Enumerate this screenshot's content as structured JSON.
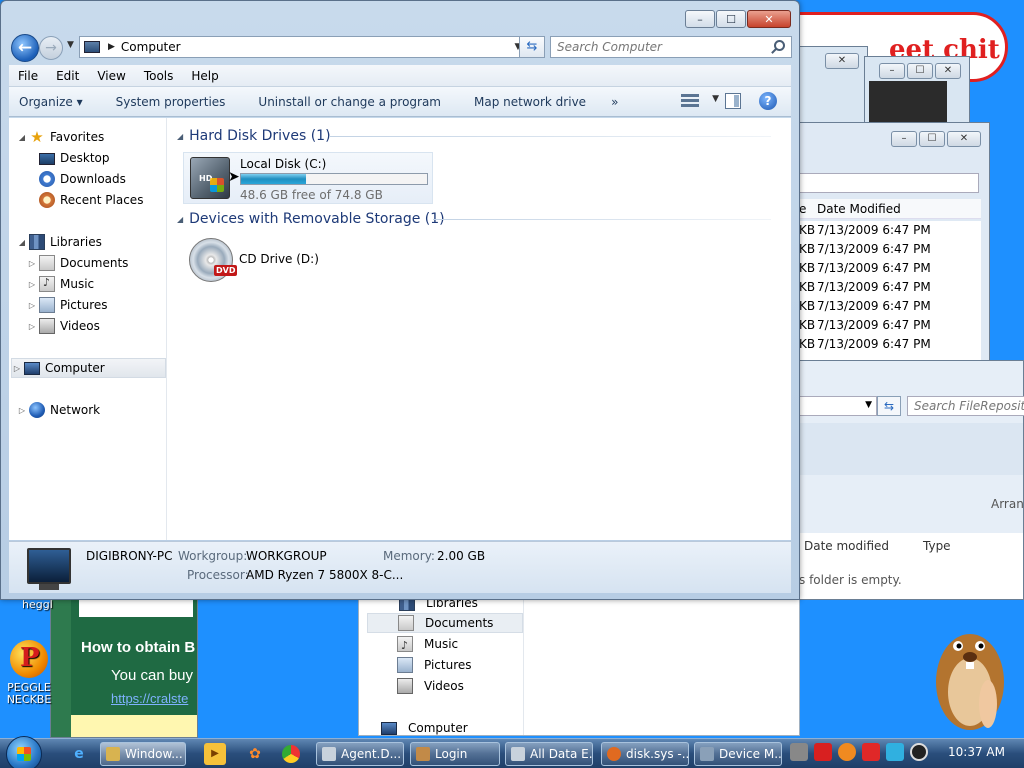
{
  "window": {
    "address": "Computer",
    "search_placeholder": "Search Computer",
    "controls": {
      "minimize": "–",
      "maximize": "☐",
      "close": "✕"
    }
  },
  "menu": [
    "File",
    "Edit",
    "View",
    "Tools",
    "Help"
  ],
  "command_bar": {
    "organize": "Organize ▾",
    "system_properties": "System properties",
    "uninstall": "Uninstall or change a program",
    "map_drive": "Map network drive",
    "more": "»"
  },
  "nav": {
    "favorites": "Favorites",
    "desktop": "Desktop",
    "downloads": "Downloads",
    "recent": "Recent Places",
    "libraries": "Libraries",
    "documents": "Documents",
    "music": "Music",
    "pictures": "Pictures",
    "videos": "Videos",
    "computer": "Computer",
    "network": "Network"
  },
  "groups": {
    "hdd": "Hard Disk Drives (1)",
    "removable": "Devices with Removable Storage (1)"
  },
  "drives": {
    "local": {
      "name": "Local Disk (C:)",
      "free": "48.6 GB free of 74.8 GB",
      "used_fraction": 0.35,
      "icon_text": "HD"
    },
    "cd": {
      "name": "CD Drive (D:)",
      "tag": "DVD"
    }
  },
  "details": {
    "pc_name": "DIGIBRONY-PC",
    "workgroup_label": "Workgroup:",
    "workgroup": "WORKGROUP",
    "memory_label": "Memory:",
    "memory": "2.00 GB",
    "processor_label": "Processor:",
    "processor": "AMD Ryzen 7 5800X 8-C..."
  },
  "background": {
    "banner_text": "eet chit",
    "win3": {
      "header": "Date Modified",
      "size_col": "e",
      "rows": [
        {
          "size": "KB",
          "date": "7/13/2009 6:47 PM"
        },
        {
          "size": "KB",
          "date": "7/13/2009 6:47 PM"
        },
        {
          "size": "KB",
          "date": "7/13/2009 6:47 PM"
        },
        {
          "size": "KB",
          "date": "7/13/2009 6:47 PM"
        },
        {
          "size": "KB",
          "date": "7/13/2009 6:47 PM"
        },
        {
          "size": "KB",
          "date": "7/13/2009 6:47 PM"
        },
        {
          "size": "KB",
          "date": "7/13/2009 6:47 PM"
        }
      ]
    },
    "win4": {
      "search": "Search FileRepository",
      "arrange": "Arrang",
      "col_date": "Date modified",
      "col_type": "Type",
      "empty": "s folder is empty."
    },
    "win5": {
      "libraries": "Libraries",
      "documents": "Documents",
      "music": "Music",
      "pictures": "Pictures",
      "videos": "Videos",
      "computer": "Computer"
    },
    "win6": {
      "title": "How to obtain B",
      "body": "You can buy",
      "link": "https://cralste"
    },
    "desktop_icons": {
      "hegg": "heggl",
      "peggle": "PEGGLE NECKBE"
    }
  },
  "taskbar": {
    "buttons": [
      "Window...",
      "Agent.D...",
      "Login",
      "All Data E...",
      "disk.sys -...",
      "Device M..."
    ],
    "clock": "10:37 AM"
  }
}
